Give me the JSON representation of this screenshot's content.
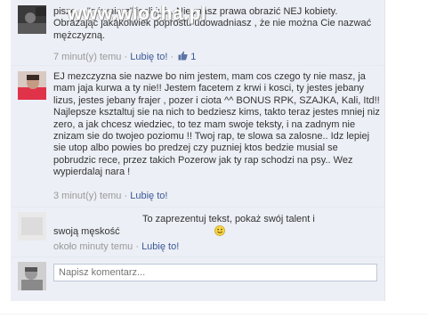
{
  "watermark": "www.wiocha.pl",
  "comments": [
    {
      "author": "",
      "text": "pisze ,, \"gówniarz\" jesli już . Nie masz prawa obrazić NEJ kobiety. Obrażając jakąkolwiek poprostu udowadniasz , że nie można Cie nazwać mężczyzną.",
      "time": "7 minut(y) temu",
      "like": "Lubię to!",
      "like_count": "1"
    },
    {
      "author": "",
      "text": "EJ mezczyzna sie nazwe bo nim jestem, mam cos czego ty nie masz, ja mam jaja kurwa a ty nie!! Jestem facetem z krwi i kosci, ty jestes jebany lizus, jestes jebany frajer , pozer i ciota ^^ BONUS RPK, SZAJKA, Kali, Itd!! Najlepsze ksztaltuj sie na nich to bedziesz kims, takto teraz jestes mniej niz zero, a jak chcesz wiedziec, to tez mam swoje teksty, i na zadnym nie znizam sie do twojeo poziomu !! Twoj rap, te slowa sa zalosne.. Idz lepiej sie utop albo powies bo predzej czy puzniej ktos bedzie musial se pobrudzic rece, przez takich Pozerow jak ty rap schodzi na psy.. Wez wypierdalaj nara !",
      "time": "3 minut(y) temu",
      "like": "Lubię to!"
    },
    {
      "author": "",
      "text": "To zaprezentuj tekst, pokaż swój talent i swoją męskość",
      "time": "około minuty temu",
      "like": "Lubię to!"
    }
  ],
  "composer": {
    "placeholder": "Napisz komentarz..."
  },
  "icons": {
    "like": "thumbs-up-icon",
    "smiley": "smiley-icon"
  },
  "colors": {
    "link": "#3b5998",
    "meta": "#999999",
    "panel": "#eceff5"
  }
}
